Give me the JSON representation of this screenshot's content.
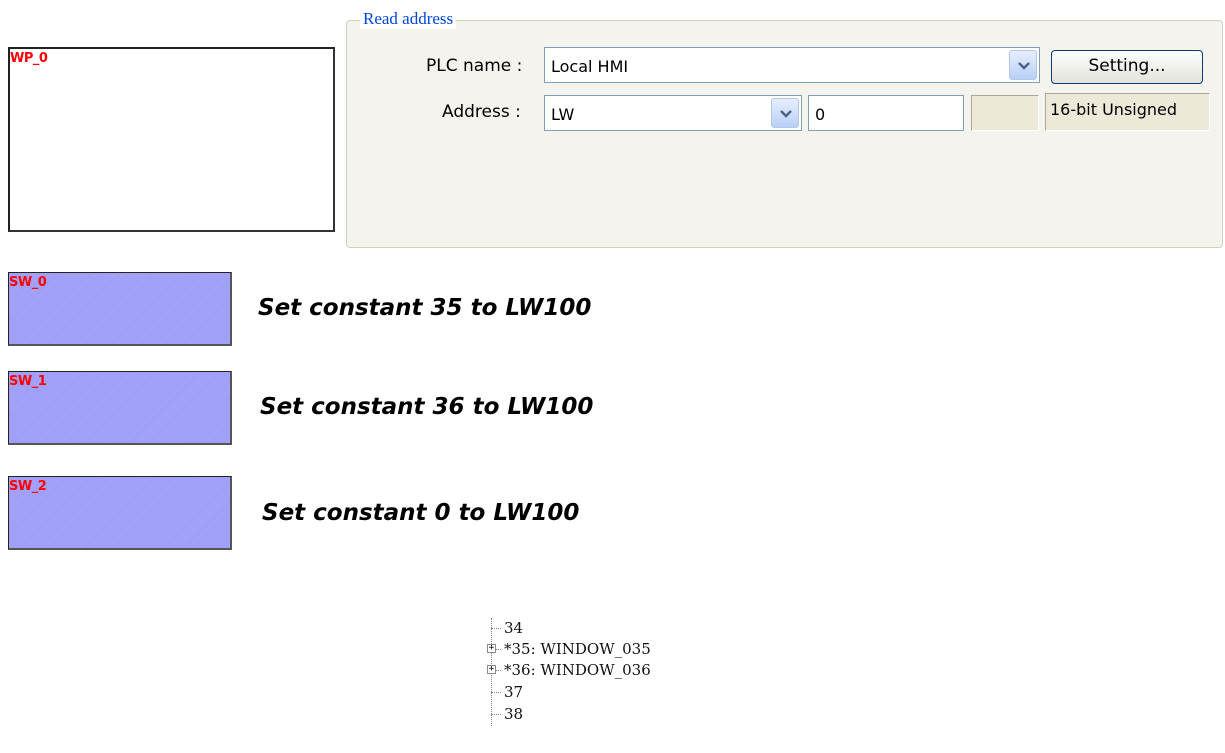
{
  "window_placeholder": {
    "tag": "WP_0"
  },
  "read_address": {
    "group_title": "Read address",
    "plc_name_label": "PLC name :",
    "plc_name_value": "Local HMI",
    "setting_button": "Setting...",
    "address_label": "Address :",
    "address_device": "LW",
    "address_number": "0",
    "data_type": "16-bit Unsigned"
  },
  "set_word_buttons": [
    {
      "tag": "SW_0",
      "caption": "Set constant 35 to LW100"
    },
    {
      "tag": "SW_1",
      "caption": "Set constant 36 to LW100"
    },
    {
      "tag": "SW_2",
      "caption": "Set constant 0 to LW100"
    }
  ],
  "window_tree": [
    {
      "label": "34",
      "expandable": false
    },
    {
      "label": "*35: WINDOW_035",
      "expandable": true
    },
    {
      "label": "*36: WINDOW_036",
      "expandable": true
    },
    {
      "label": "37",
      "expandable": false
    },
    {
      "label": "38",
      "expandable": false
    }
  ]
}
